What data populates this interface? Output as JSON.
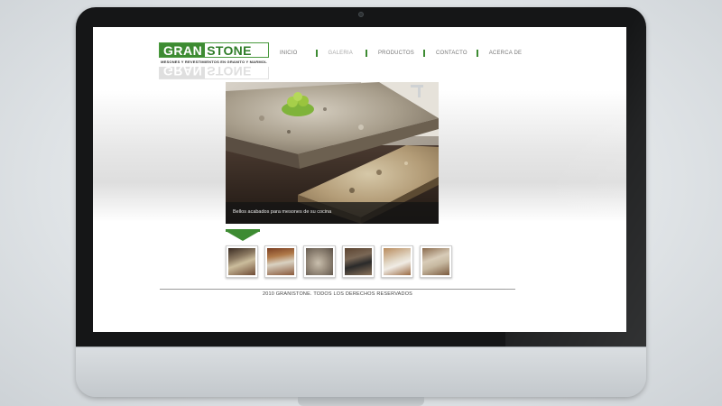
{
  "site": {
    "logo": {
      "prefix": "GRAN",
      "suffix": "STONE",
      "tagline": "MESONES Y REVESTIMIENTOS EN GRANITO Y MARMOL",
      "brand_color": "#3d8b32"
    },
    "nav": {
      "items": [
        {
          "label": "INICIO"
        },
        {
          "label": "GALERIA",
          "active": true
        },
        {
          "label": "PRODUCTOS"
        },
        {
          "label": "CONTACTO"
        },
        {
          "label": "ACERCA DE"
        }
      ]
    },
    "slideshow": {
      "caption": "Bellos acabados para mesones de su cocina",
      "thumbnails_count": 6
    },
    "footer": {
      "copyright": "2010 GRANISTONE. TODOS LOS DERECHOS RESERVADOS"
    }
  }
}
